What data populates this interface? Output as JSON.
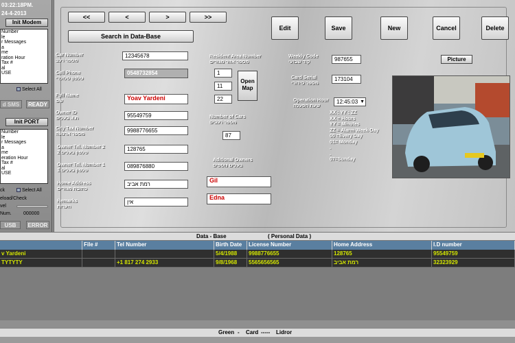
{
  "status": {
    "time": "03:22:18PM.",
    "date": "24-4-2013"
  },
  "modem": {
    "init_label": "Init Modem",
    "items": [
      "Number",
      "le",
      "r Messages",
      "a",
      "me",
      "ration Hour",
      "Tax #",
      "al",
      "USE"
    ],
    "select_all": "Select All",
    "sms_label": "d SMS",
    "ready_label": "READY"
  },
  "port": {
    "init_label": "Init PORT",
    "items": [
      "Number",
      "le",
      "r Messages",
      "a",
      "me",
      "eration Hour",
      "Tax #",
      "al",
      "USE"
    ],
    "select_all": "Select All",
    "check_label": "ck",
    "reload_label": "eload/Check",
    "level_label": "vel",
    "num_label": "Num.",
    "num_value": "000000",
    "usb_label": "USB",
    "error_label": "ERROR"
  },
  "nav": {
    "first": "<<",
    "prev": "<",
    "next": ">",
    "last": ">>",
    "search": "Search in Data-Base"
  },
  "actions": {
    "edit": "Edit",
    "save": "Save",
    "new": "New",
    "cancel": "Cancel",
    "delete": "Delete"
  },
  "form": {
    "car_number": {
      "label": "Car Number",
      "label_he": "מספר רכב",
      "value": "12345678"
    },
    "cell_phone": {
      "label": "Cell Phone",
      "label_he": "טלפון סלולרי",
      "value": "0548732854"
    },
    "full_name": {
      "label": "Full Name",
      "label_he": "שם",
      "value": "Yoav Yardeni"
    },
    "owner_id": {
      "label": "Owner ID",
      "label_he": "ת.ז. בעלים",
      "value": "95549759"
    },
    "city_tax": {
      "label": "City Tax Number",
      "label_he": "מספר ארנונה",
      "value": "9988776655"
    },
    "owner_tel2": {
      "label": "Owner Tel. Number 2",
      "label_he": "2 טלפון בעלים",
      "value": "128765"
    },
    "owner_tel1": {
      "label": "Owner Tel. Number 1",
      "label_he": "1 טלפון בעלים",
      "value": "089876880"
    },
    "home_address": {
      "label": "Home Address",
      "label_he": "כתובת מגורים",
      "value": "רמת אביב"
    },
    "remarks": {
      "label": "Remarks",
      "label_he": "הערות",
      "value": "אין"
    },
    "resident_area": {
      "label": "Resident Area Number",
      "label_he": "מספר אזור מגורים",
      "values": [
        "1",
        "11",
        "22"
      ]
    },
    "open_map": "Open Map",
    "number_of_cars": {
      "label": "Number of Cars",
      "label_he": "מספר רכבים",
      "value": "87"
    },
    "additional_owners": {
      "label": "Aditional Owners",
      "label_he": "בעלים נוספים",
      "values": [
        "Gil",
        "Edna"
      ]
    },
    "weekly_code": {
      "label": "Weekly Code",
      "label_he": "קוד שבועי",
      "value": "987655"
    },
    "card_serial": {
      "label": "Card Serial",
      "label_he": "מספר סידורי",
      "value": "173104"
    },
    "operation_hour": {
      "label": "Operation Hour",
      "label_he": "שעת הפעלה",
      "value": "12:45:03"
    },
    "picture_button": "Picture",
    "legend": [
      "XX : YY : ZZ",
      "XX = Hours",
      "YY = Minutes",
      "",
      "ZZ = Alarm Week-Day",
      "",
      "00 =Every Day",
      "01= Monday",
      ".",
      ".",
      "07=Sunday"
    ]
  },
  "grid": {
    "title": "Data  -  Base",
    "subtitle": "( Personal Data )",
    "columns": [
      "File #",
      "Tel Number",
      "Birth Date",
      "License Number",
      "Home Address",
      "I.D number"
    ],
    "rows": [
      [
        "v Yardeni",
        "",
        "",
        "5/4/1988",
        "9988776655",
        "128765",
        "95549759"
      ],
      [
        "TYTYTY",
        "",
        "+1 817 274 2933",
        "9/8/1968",
        "5565656565",
        "רמת אביב",
        "32323929"
      ]
    ]
  },
  "footer": {
    "green": "Green",
    "card": "Card",
    "lidror": "Lidror"
  },
  "colors": {
    "grid_text": "#d4e600",
    "grid_header": "#5a7fa0",
    "name_red": "#cc0000"
  }
}
